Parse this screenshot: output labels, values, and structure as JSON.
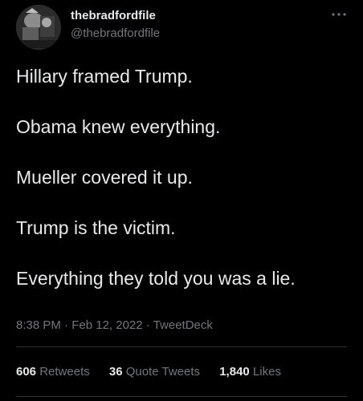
{
  "author": {
    "display_name": "thebradfordfile",
    "handle": "@thebradfordfile"
  },
  "icons": {
    "more": "more-horizontal-icon",
    "avatar": "profile-photo"
  },
  "tweet": {
    "lines": [
      "Hillary framed Trump.",
      "Obama knew everything.",
      "Mueller covered it up.",
      "Trump is the victim.",
      "Everything they told you was a lie."
    ],
    "time": "8:38 PM",
    "date": "Feb 12, 2022",
    "source": "TweetDeck",
    "separator": "·"
  },
  "stats": {
    "retweets": {
      "count": "606",
      "label": "Retweets"
    },
    "quotes": {
      "count": "36",
      "label": "Quote Tweets"
    },
    "likes": {
      "count": "1,840",
      "label": "Likes"
    }
  },
  "colors": {
    "background": "#000000",
    "text": "#e7e9ea",
    "secondary": "#71767b",
    "divider": "#2f3336"
  }
}
